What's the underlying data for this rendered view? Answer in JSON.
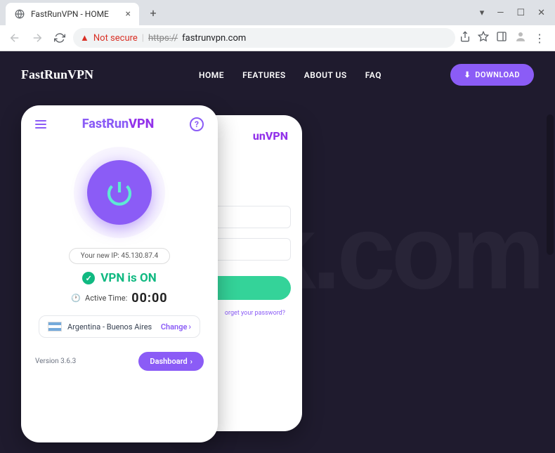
{
  "browser": {
    "tab_title": "FastRunVPN - HOME",
    "not_secure_label": "Not secure",
    "url_protocol": "https://",
    "url_domain": "fastrunvpn.com"
  },
  "header": {
    "logo": "FastRunVPN",
    "nav": {
      "home": "HOME",
      "features": "FEATURES",
      "about": "ABOUT US",
      "faq": "FAQ"
    },
    "download_label": "DOWNLOAD"
  },
  "app": {
    "logo_fr": "FastRun",
    "logo_vpn": "VPN",
    "ip_label": "Your new IP: 45.130.87.4",
    "vpn_status": "VPN is ON",
    "active_time_label": "Active Time:",
    "active_time_value": "00:00",
    "location": "Argentina - Buenos Aires",
    "change_label": "Change",
    "version": "Version 3.6.3",
    "dashboard_label": "Dashboard"
  },
  "app_back": {
    "logo_suffix": "unVPN",
    "forgot_label": "orget your password?"
  },
  "watermark": "pcrisk.com",
  "colors": {
    "accent": "#8b5cf6",
    "success": "#10b981",
    "bg": "#1f1b2e"
  }
}
